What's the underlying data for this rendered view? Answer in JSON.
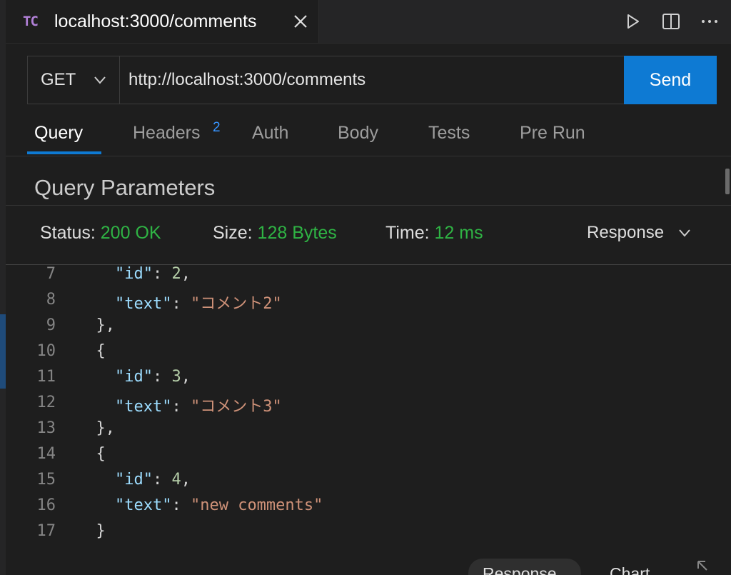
{
  "tab": {
    "badge": "TC",
    "title": "localhost:3000/comments"
  },
  "icons": {
    "tab_close": "close-icon",
    "run": "play-icon",
    "split": "split-editor-icon",
    "more": "ellipsis-icon",
    "method_chevron": "chevron-down-icon",
    "response_chevron": "chevron-down-icon",
    "resize": "resize-icon"
  },
  "request": {
    "method": "GET",
    "url": "http://localhost:3000/comments",
    "send_label": "Send"
  },
  "request_tabs": [
    {
      "label": "Query",
      "active": true
    },
    {
      "label": "Headers",
      "badge": "2"
    },
    {
      "label": "Auth"
    },
    {
      "label": "Body"
    },
    {
      "label": "Tests"
    },
    {
      "label": "Pre Run"
    }
  ],
  "query_section_title": "Query Parameters",
  "status": {
    "status_label": "Status:",
    "status_value": "200 OK",
    "size_label": "Size:",
    "size_value": "128 Bytes",
    "time_label": "Time:",
    "time_value": "12 ms",
    "view_select": "Response"
  },
  "code_lines": [
    {
      "n": "7",
      "text": "    \"id\": 2,"
    },
    {
      "n": "8",
      "text": "    \"text\": \"コメント2\""
    },
    {
      "n": "9",
      "text": "  },"
    },
    {
      "n": "10",
      "text": "  {"
    },
    {
      "n": "11",
      "text": "    \"id\": 3,"
    },
    {
      "n": "12",
      "text": "    \"text\": \"コメント3\""
    },
    {
      "n": "13",
      "text": "  },"
    },
    {
      "n": "14",
      "text": "  {"
    },
    {
      "n": "15",
      "text": "    \"id\": 4,"
    },
    {
      "n": "16",
      "text": "    \"text\": \"new comments\""
    },
    {
      "n": "17",
      "text": "  }"
    }
  ],
  "bottom_tabs": {
    "response": "Response",
    "chart": "Chart"
  },
  "colors": {
    "accent": "#0e7ad3",
    "status_green": "#2fb344",
    "badge_purple": "#b180d7"
  }
}
